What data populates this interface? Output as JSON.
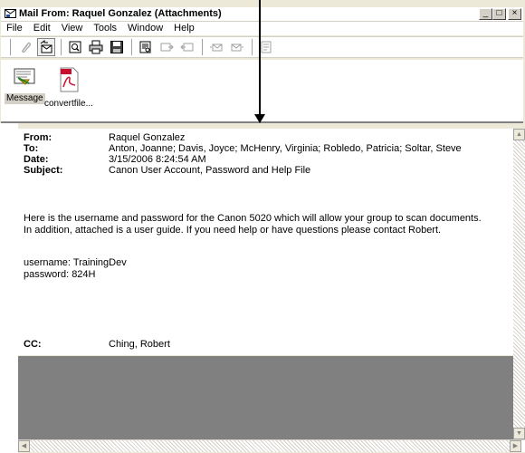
{
  "window": {
    "title": "Mail From: Raquel Gonzalez (Attachments)",
    "controls": [
      "_",
      "□",
      "×"
    ]
  },
  "menu": [
    "File",
    "Edit",
    "View",
    "Tools",
    "Window",
    "Help"
  ],
  "toolbar": {
    "buttons": [
      "attach-paperclip-icon",
      "reply-all-icon",
      "preview-icon",
      "print-icon",
      "save-icon",
      "find-icon",
      "forward-icon",
      "back-icon",
      "previous-message-icon",
      "next-message-icon",
      "properties-icon"
    ]
  },
  "attachments": [
    {
      "label": "Message",
      "icon": "message-envelope-icon",
      "selected": true
    },
    {
      "label": "convertfile...",
      "icon": "pdf-file-icon",
      "selected": false
    }
  ],
  "header": {
    "from_label": "From:",
    "from_value": "Raquel Gonzalez",
    "to_label": "To:",
    "to_value": "Anton, Joanne;  Davis, Joyce;  McHenry, Virginia;  Robledo, Patricia;  Soltar, Steve",
    "date_label": "Date:",
    "date_value": "3/15/2006 8:24:54 AM",
    "subject_label": "Subject:",
    "subject_value": "Canon User Account, Password and Help File"
  },
  "body": {
    "line1": "Here is the username and password for the Canon 5020  which will allow your group to scan documents.",
    "line2": "In addition, attached is a user guide.  If you need help or have questions please contact Robert.",
    "username": "username: TrainingDev",
    "password": "password: 824H"
  },
  "cc": {
    "label": "CC:",
    "value": "Ching, Robert"
  },
  "colors": {
    "chrome": "#ece9d8",
    "gray_area": "#808080",
    "pdf_red": "#c8102e"
  }
}
